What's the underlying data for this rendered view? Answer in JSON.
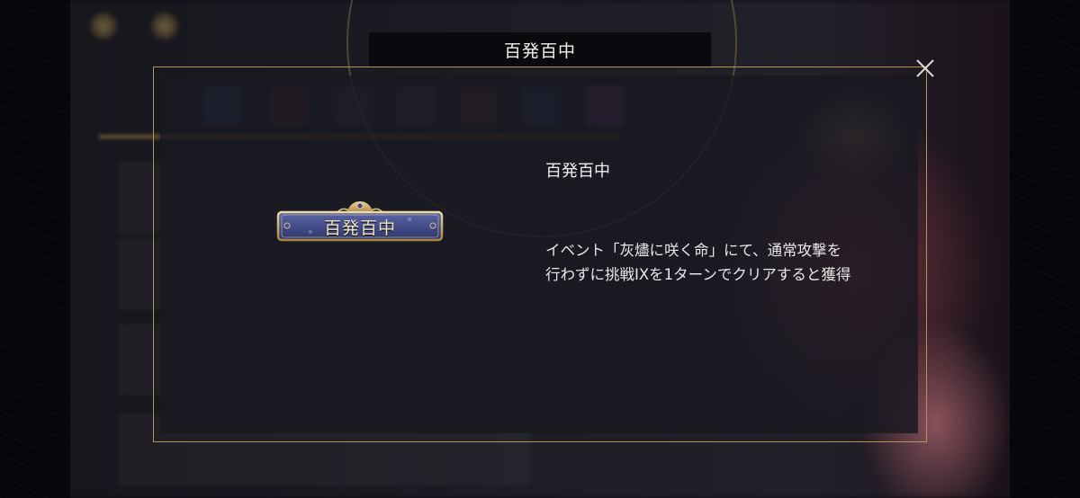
{
  "dialog": {
    "title": "百発百中",
    "close_icon": "close-icon"
  },
  "badge": {
    "label": "百発百中"
  },
  "achievement": {
    "name": "百発百中",
    "description_line1": "イベント「灰燼に咲く命」にて、通常攻撃を",
    "description_line2": "行わずに挑戦IXを1ターンでクリアすると獲得"
  },
  "colors": {
    "frame_gold": "#b79455",
    "badge_blue": "#3d4680",
    "text": "#f0f0f0"
  }
}
